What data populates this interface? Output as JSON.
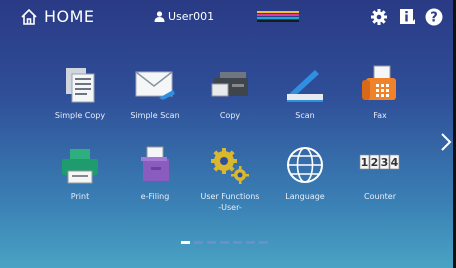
{
  "header": {
    "home_label": "HOME",
    "user_name": "User001",
    "toner_colors": [
      "#f2c230",
      "#e0399a",
      "#1fa7d8",
      "#1a1a1a"
    ],
    "icons": [
      "gear-icon",
      "info-icon",
      "help-icon"
    ],
    "help_glyph": "?",
    "info_glyph": "i"
  },
  "apps": [
    {
      "label": "Simple Copy",
      "icon": "simple-copy-icon"
    },
    {
      "label": "Simple Scan",
      "icon": "simple-scan-icon"
    },
    {
      "label": "Copy",
      "icon": "copy-icon"
    },
    {
      "label": "Scan",
      "icon": "scan-icon"
    },
    {
      "label": "Fax",
      "icon": "fax-icon"
    },
    {
      "label": "Print",
      "icon": "print-icon"
    },
    {
      "label": "e-Filing",
      "icon": "efiling-icon"
    },
    {
      "label": "User Functions\n-User-",
      "icon": "user-functions-icon"
    },
    {
      "label": "Language",
      "icon": "language-icon"
    },
    {
      "label": "Counter",
      "icon": "counter-icon"
    }
  ],
  "counter_digits": [
    "1",
    "2",
    "3",
    "4"
  ],
  "pager": {
    "total_pages": 7,
    "current_page": 1
  }
}
